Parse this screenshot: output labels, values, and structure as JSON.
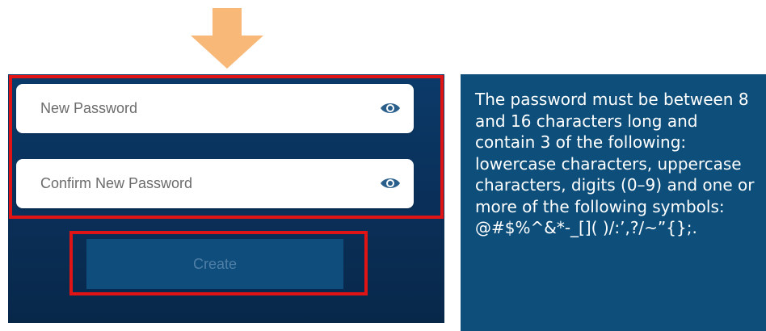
{
  "form": {
    "new_password": {
      "placeholder": "New Password",
      "value": ""
    },
    "confirm_password": {
      "placeholder": "Confirm New Password",
      "value": ""
    },
    "create_label": "Create"
  },
  "info": {
    "text": "The password must be between 8 and 16 characters long and contain 3 of the following:  lowercase characters, uppercase characters, digits (0–9) and one or more of the following symbols:  @#$%^&*-_[]( )/:’,?/~”{};."
  },
  "icons": {
    "arrow": "arrow-down-icon",
    "eye": "eye-icon"
  },
  "colors": {
    "arrow": "#f8b878",
    "panel": "#0b3a69",
    "info_panel": "#0d4e7a",
    "highlight": "#e01414",
    "eye": "#2a5f8c"
  }
}
